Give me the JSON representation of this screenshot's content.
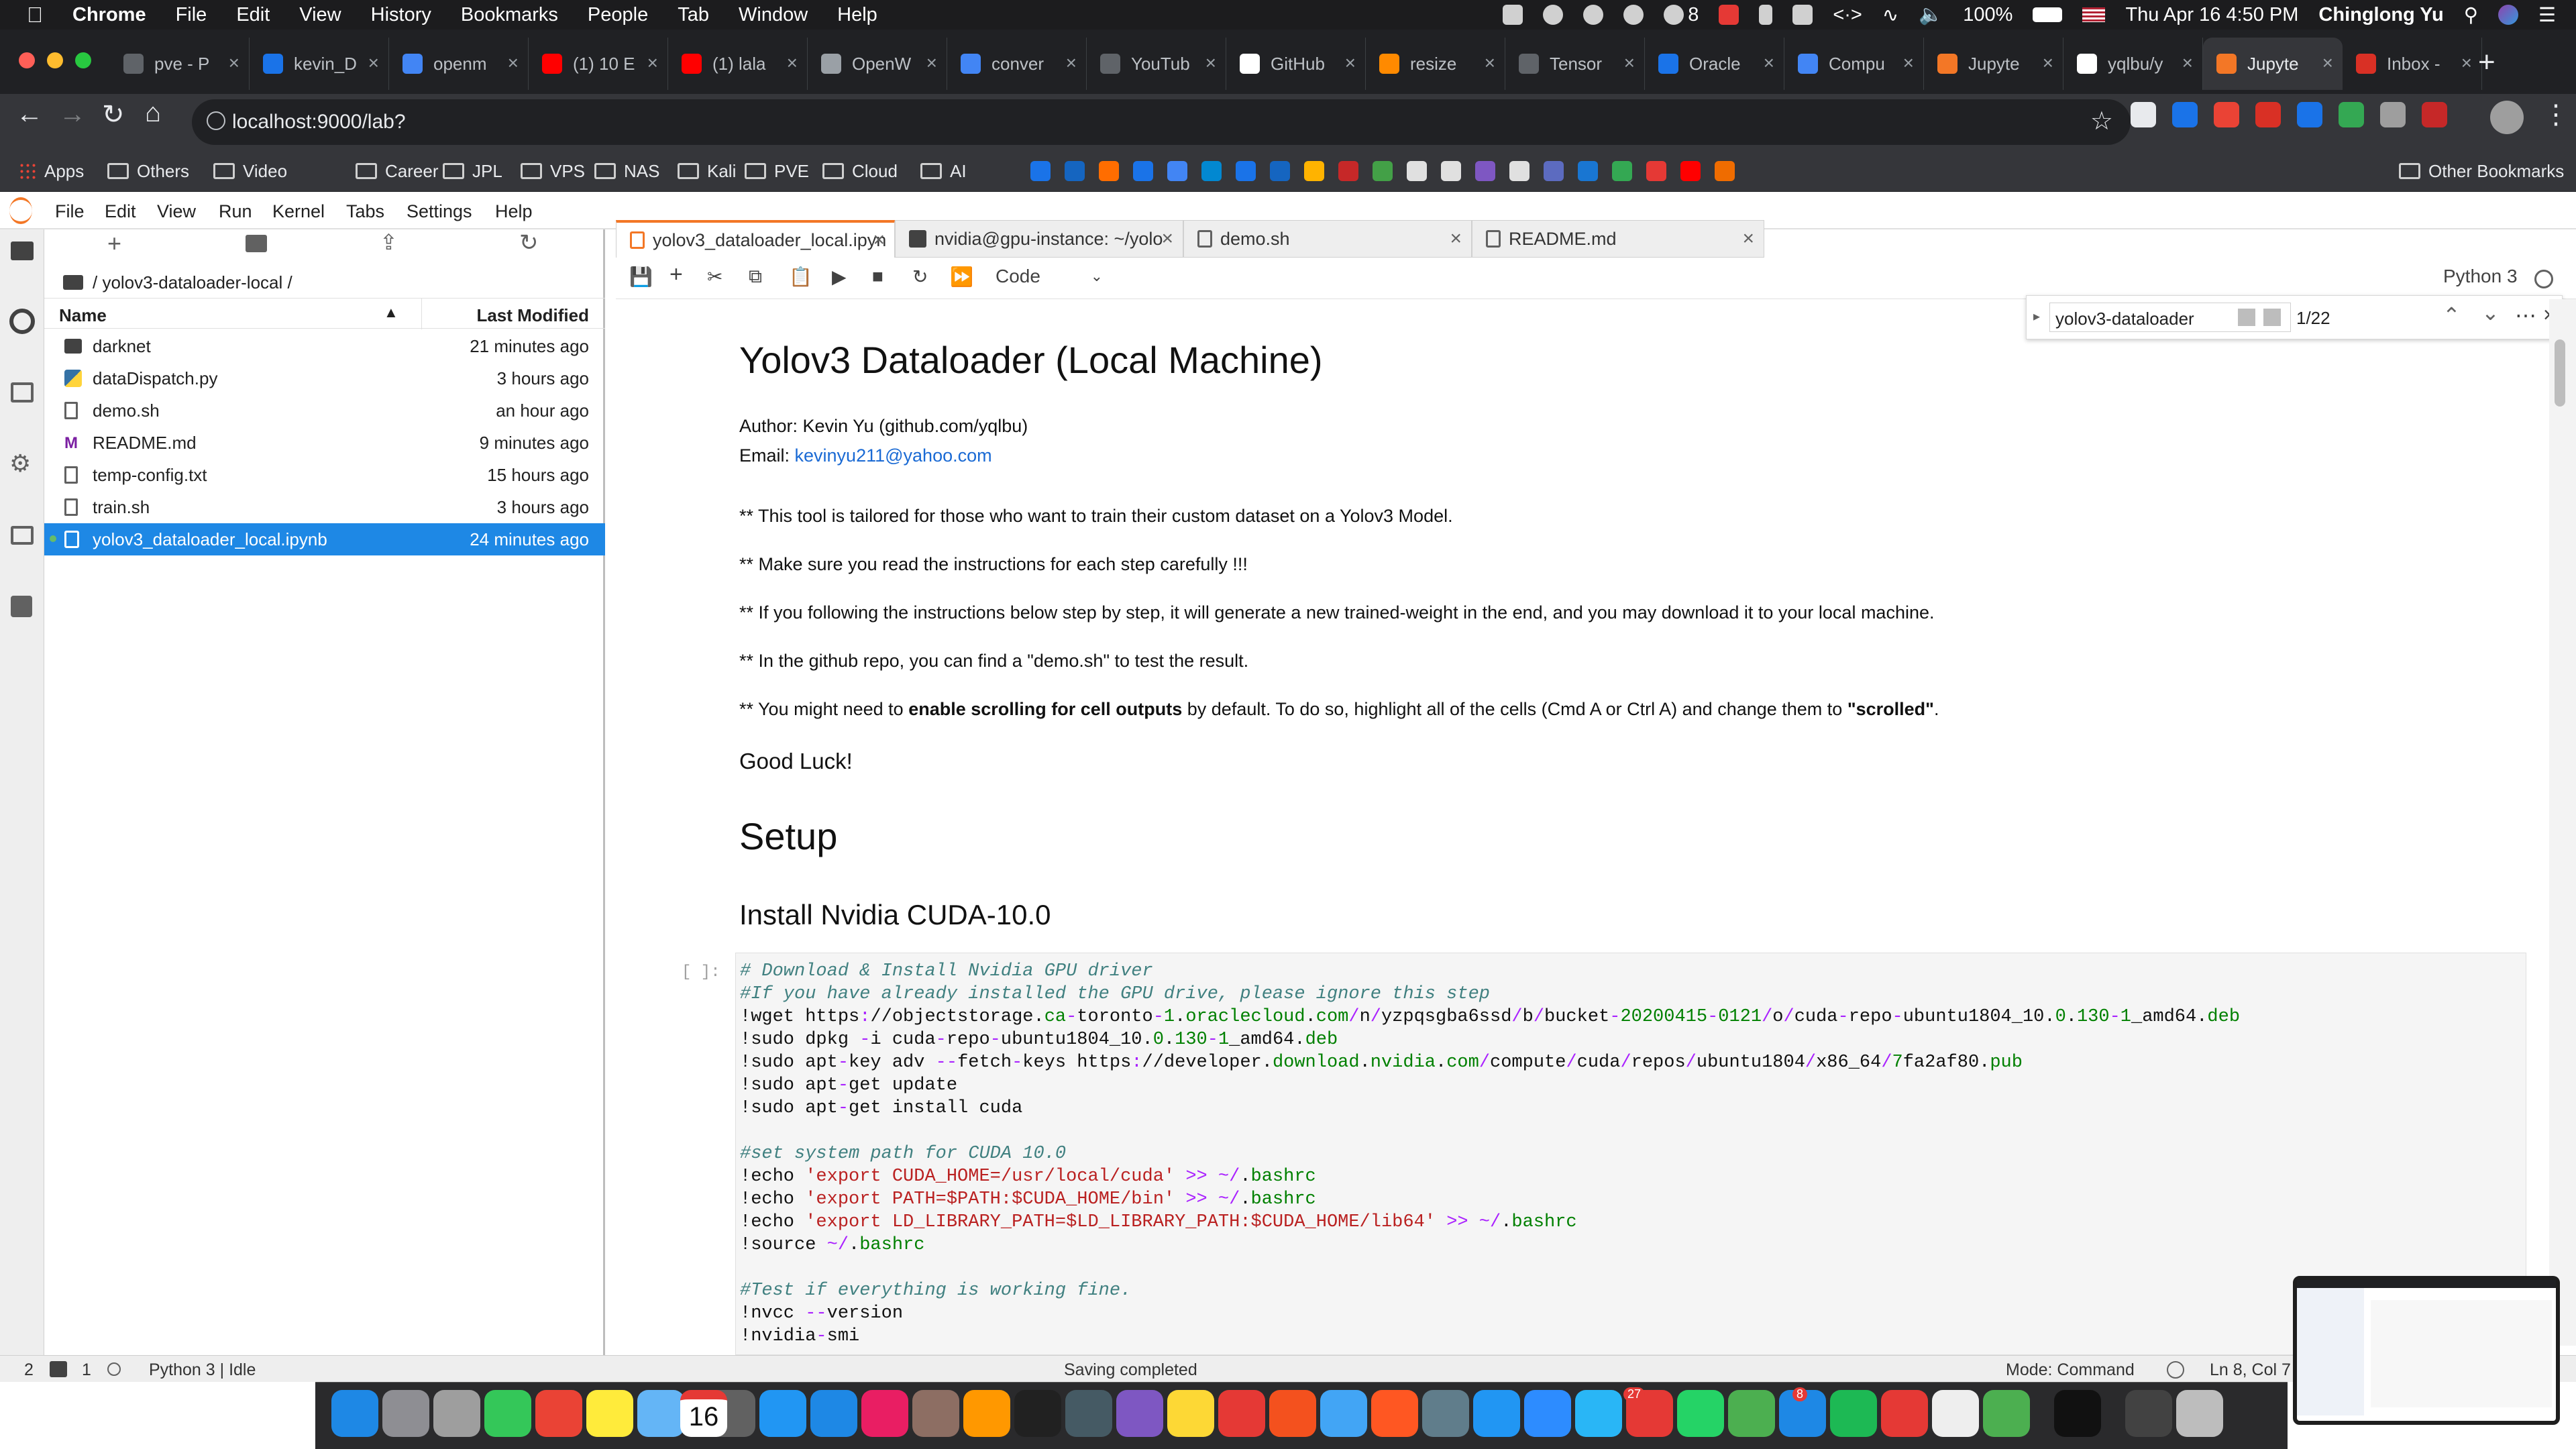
{
  "menubar": {
    "app": "Chrome",
    "items": [
      "File",
      "Edit",
      "View",
      "History",
      "Bookmarks",
      "People",
      "Tab",
      "Window",
      "Help"
    ],
    "wechat_badge": "8",
    "battery": "100%",
    "datetime": "Thu Apr 16  4:50 PM",
    "user": "Chinglong Yu"
  },
  "chrome": {
    "tabs": [
      {
        "label": "pve - P",
        "color": "#5f6368"
      },
      {
        "label": "kevin_D",
        "color": "#1a73e8"
      },
      {
        "label": "openm",
        "color": "#4285f4"
      },
      {
        "label": "(1) 10 E",
        "color": "#ff0000"
      },
      {
        "label": "(1) lala",
        "color": "#ff0000"
      },
      {
        "label": "OpenW",
        "color": "#9aa0a6"
      },
      {
        "label": "conver",
        "color": "#4285f4"
      },
      {
        "label": "YouTub",
        "color": "#5f6368"
      },
      {
        "label": "GitHub",
        "color": "#ffffff"
      },
      {
        "label": "resize",
        "color": "#ff8a00"
      },
      {
        "label": "Tensor",
        "color": "#5f6368"
      },
      {
        "label": "Oracle",
        "color": "#1a73e8"
      },
      {
        "label": "Compu",
        "color": "#4285f4"
      },
      {
        "label": "Jupyte",
        "color": "#f37726"
      },
      {
        "label": "yqlbu/y",
        "color": "#ffffff"
      },
      {
        "label": "Jupyte",
        "color": "#f37726",
        "active": true
      },
      {
        "label": "Inbox -",
        "color": "#d93025"
      }
    ],
    "url": "localhost:9000/lab?",
    "bookmarks": [
      "Apps",
      "Others",
      "Video",
      "Career",
      "JPL",
      "VPS",
      "NAS",
      "Kali",
      "PVE",
      "Cloud",
      "AI"
    ],
    "other_bookmarks": "Other Bookmarks"
  },
  "jupyter": {
    "menu": [
      "File",
      "Edit",
      "View",
      "Run",
      "Kernel",
      "Tabs",
      "Settings",
      "Help"
    ],
    "breadcrumb": "/ yolov3-dataloader-local /",
    "columns": {
      "name": "Name",
      "modified": "Last Modified"
    },
    "files": [
      {
        "name": "darknet",
        "modified": "21 minutes ago",
        "type": "folder"
      },
      {
        "name": "dataDispatch.py",
        "modified": "3 hours ago",
        "type": "python"
      },
      {
        "name": "demo.sh",
        "modified": "an hour ago",
        "type": "file"
      },
      {
        "name": "README.md",
        "modified": "9 minutes ago",
        "type": "markdown"
      },
      {
        "name": "temp-config.txt",
        "modified": "15 hours ago",
        "type": "file"
      },
      {
        "name": "train.sh",
        "modified": "3 hours ago",
        "type": "file"
      },
      {
        "name": "yolov3_dataloader_local.ipynb",
        "modified": "24 minutes ago",
        "type": "notebook",
        "selected": true
      }
    ],
    "tabs": [
      "yolov3_dataloader_local.ipyn",
      "nvidia@gpu-instance: ~/yolo",
      "demo.sh",
      "README.md"
    ],
    "celltype": "Code",
    "kernel": "Python 3",
    "find": {
      "query": "yolov3-dataloader",
      "count": "1/22"
    },
    "prompt": "[ ]:",
    "notebook": {
      "title": "Yolov3 Dataloader (Local Machine)",
      "author": "Author: Kevin Yu (github.com/yqlbu)",
      "email_label": "Email: ",
      "email": "kevinyu211@yahoo.com",
      "p1": "** This tool is tailored for those who want to train their custom dataset on a Yolov3 Model.",
      "p2": "** Make sure you read the instructions for each step carefully !!!",
      "p3": "** If you following the instructions below step by step, it will generate a new trained-weight in the end, and you may download it to your local machine.",
      "p4": "** In the github repo, you can find a \"demo.sh\" to test the result.",
      "p5_a": "** You might need to ",
      "p5_b": "enable scrolling for cell outputs",
      "p5_c": " by default. To do so, highlight all of the cells (Cmd A or Ctrl A) and change them to ",
      "p5_d": "\"scrolled\"",
      "p5_e": ".",
      "good_luck": "Good Luck!",
      "h_setup": "Setup",
      "h_cuda": "Install Nvidia CUDA-10.0"
    },
    "status": {
      "left_num": "2",
      "term_num": "1",
      "kernel": "Python 3 | Idle",
      "saving": "Saving completed",
      "mode": "Mode: Command",
      "position": "Ln 8, Col 7"
    }
  },
  "dock": {
    "calendar_date": "16",
    "mail_badge": "27",
    "badge2": "8"
  }
}
